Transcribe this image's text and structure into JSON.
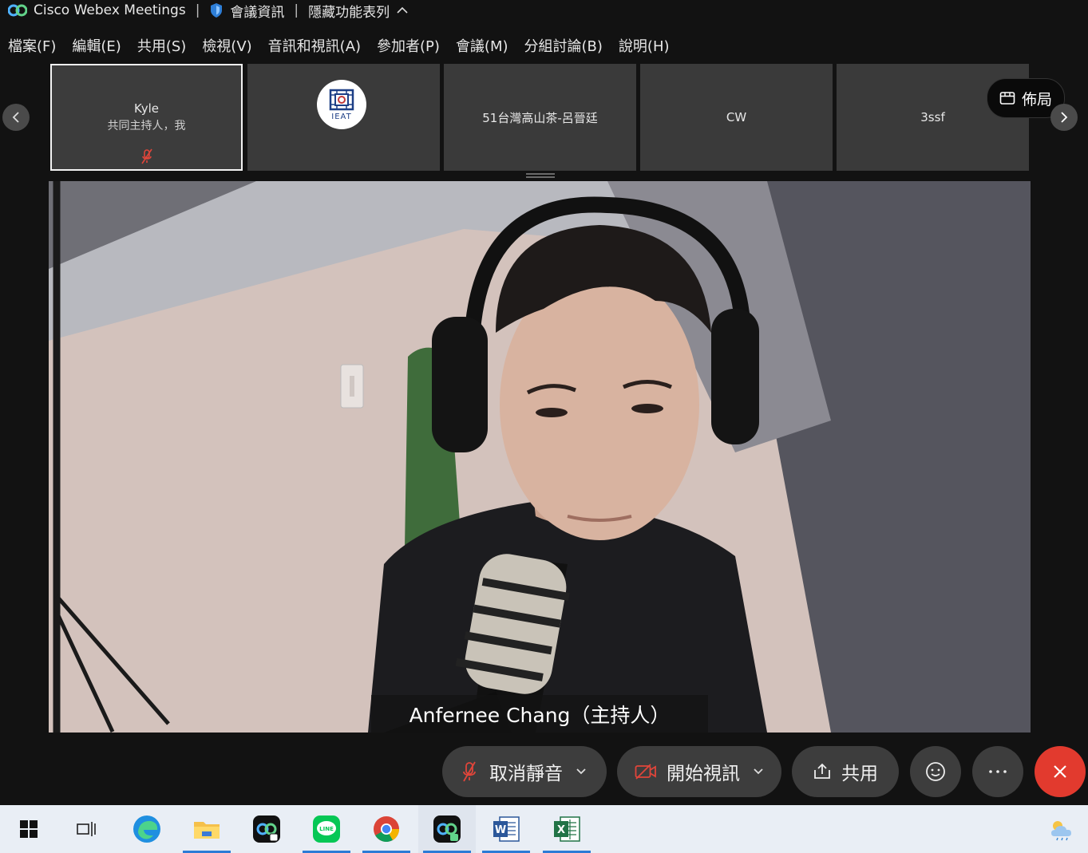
{
  "titlebar": {
    "app_title": "Cisco Webex Meetings",
    "meeting_info": "會議資訊",
    "hide_menu": "隱藏功能表列"
  },
  "menu": [
    {
      "label": "檔案(F)"
    },
    {
      "label": "編輯(E)"
    },
    {
      "label": "共用(S)"
    },
    {
      "label": "檢視(V)"
    },
    {
      "label": "音訊和視訊(A)"
    },
    {
      "label": "參加者(P)"
    },
    {
      "label": "會議(M)"
    },
    {
      "label": "分組討論(B)"
    },
    {
      "label": "說明(H)"
    }
  ],
  "participants": [
    {
      "name": "Kyle",
      "role": "共同主持人，我"
    },
    {
      "name": "",
      "avatar_text": "IEAT"
    },
    {
      "name": "51台灣高山茶-呂晉廷"
    },
    {
      "name": "CW"
    },
    {
      "name": "3ssf"
    }
  ],
  "layout_button": "佈局",
  "main_video": {
    "speaker_label": "Anfernee Chang（主持人）"
  },
  "controls": {
    "unmute": "取消靜音",
    "start_video": "開始視訊",
    "share": "共用"
  },
  "colors": {
    "end_call": "#e23a2e",
    "mute_red": "#e0453a",
    "webex_blue": "#2b7bd6"
  },
  "taskbar_apps": [
    "windows-start",
    "task-view",
    "edge",
    "file-explorer",
    "webex-meetings",
    "line",
    "chrome",
    "webex",
    "word",
    "excel"
  ]
}
